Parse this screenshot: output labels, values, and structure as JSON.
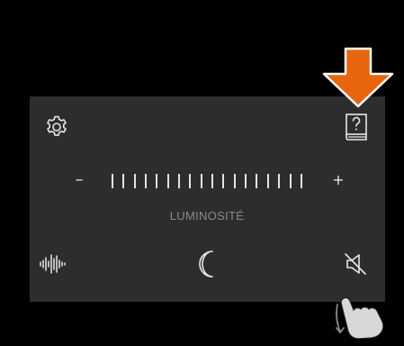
{
  "brightness": {
    "minus_label": "–",
    "plus_label": "+",
    "label": "LUMINOSITÉ",
    "tick_count": 18
  },
  "icons": {
    "settings": "gear-icon",
    "help": "help-book-icon",
    "sound": "sound-wave-icon",
    "night_mode": "moon-icon",
    "mute": "speaker-mute-icon",
    "pointer": "down-arrow-indicator",
    "gesture": "hand-swipe-gesture-icon"
  },
  "colors": {
    "panel": "#2d2d2d",
    "foreground": "#e8e8e8",
    "label": "#8a8a8a",
    "arrow": "#e8650f"
  }
}
